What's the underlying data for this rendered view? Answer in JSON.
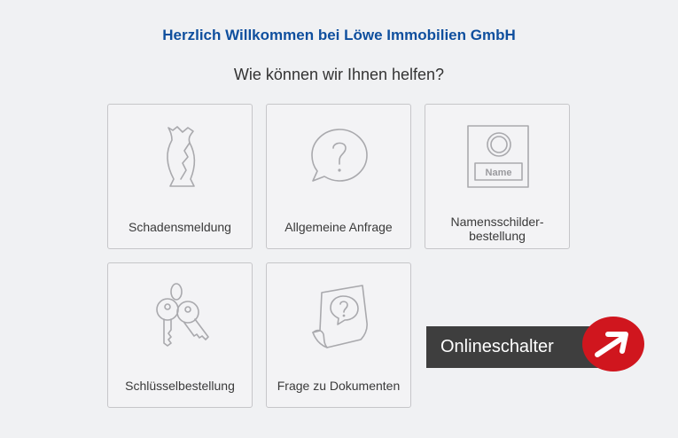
{
  "header": {
    "title": "Herzlich Willkommen bei Löwe Immobilien GmbH",
    "subtitle": "Wie können wir Ihnen helfen?"
  },
  "tiles": [
    {
      "label": "Schadensmeldung",
      "icon": "broken-vase-icon"
    },
    {
      "label": "Allgemeine Anfrage",
      "icon": "question-bubble-icon"
    },
    {
      "label": "Namensschilder-\nbestellung",
      "icon": "name-plate-icon",
      "icon_text": "Name"
    },
    {
      "label": "Schlüsselbestellung",
      "icon": "keys-icon"
    },
    {
      "label": "Frage zu Dokumenten",
      "icon": "document-question-icon"
    }
  ],
  "onlineschalter": {
    "label": "Onlineschalter",
    "icon": "arrow-up-right-icon",
    "colors": {
      "bar": "#3e3e3e",
      "circle": "#d0161e",
      "text": "#ffffff"
    }
  },
  "colors": {
    "background": "#f0f1f3",
    "title": "#0f4f9e",
    "tile_border": "#c6c6c9",
    "icon_stroke": "#a9a9ad"
  }
}
